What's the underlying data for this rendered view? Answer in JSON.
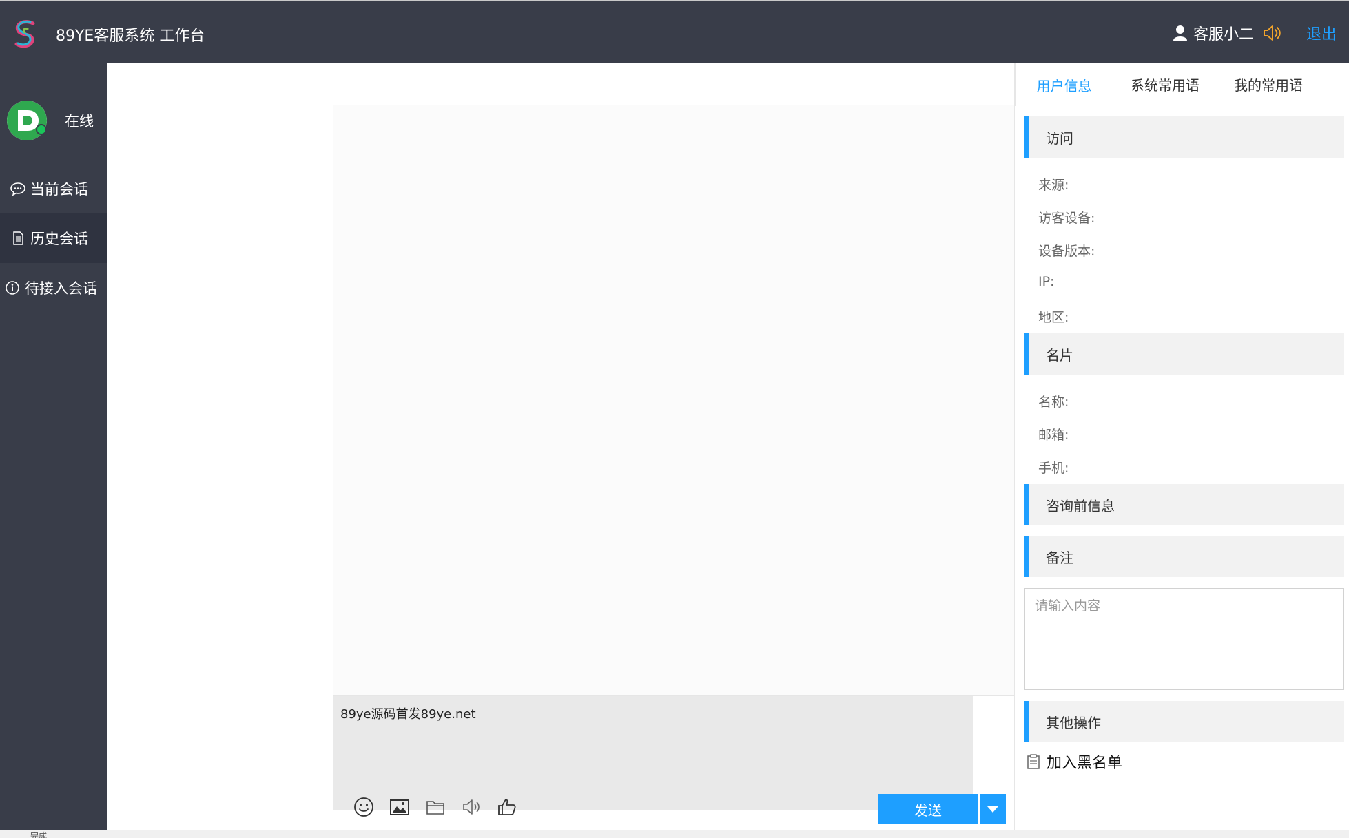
{
  "header": {
    "app_title": "89YE客服系统 工作台",
    "user_name": "客服小二",
    "logout_label": "退出",
    "logo_icon": "swirl-s-logo-icon",
    "user_icon": "person-icon",
    "sound_icon": "speaker-icon"
  },
  "sidebar": {
    "status": "在线",
    "avatar_icon": "d-logo-avatar",
    "items": [
      {
        "label": "当前会话",
        "icon": "chat-bubble-icon",
        "active": false
      },
      {
        "label": "历史会话",
        "icon": "document-icon",
        "active": true
      },
      {
        "label": "待接入会话",
        "icon": "info-icon",
        "active": false
      }
    ]
  },
  "chat": {
    "input_value": "89ye源码首发89ye.net",
    "send_label": "发送",
    "tools": [
      "emoji-icon",
      "image-icon",
      "folder-icon",
      "speaker-icon",
      "thumbs-up-icon"
    ]
  },
  "right_panel": {
    "tabs": [
      {
        "label": "用户信息",
        "active": true
      },
      {
        "label": "系统常用语",
        "active": false
      },
      {
        "label": "我的常用语",
        "active": false
      }
    ],
    "sections": {
      "visit": "访问",
      "card": "名片",
      "pre_consult": "咨询前信息",
      "remark": "备注",
      "other": "其他操作"
    },
    "visit_fields": {
      "source": "来源:",
      "device": "访客设备:",
      "version": "设备版本:",
      "ip": "IP:",
      "region": "地区:"
    },
    "card_fields": {
      "name": "名称:",
      "email": "邮箱:",
      "phone": "手机:"
    },
    "remark_placeholder": "请输入内容",
    "blacklist_label": "加入黑名单"
  },
  "statusbar": {
    "text": "完成"
  },
  "colors": {
    "header_bg": "#393d49",
    "accent": "#1e9fff",
    "online": "#1bc55a"
  }
}
